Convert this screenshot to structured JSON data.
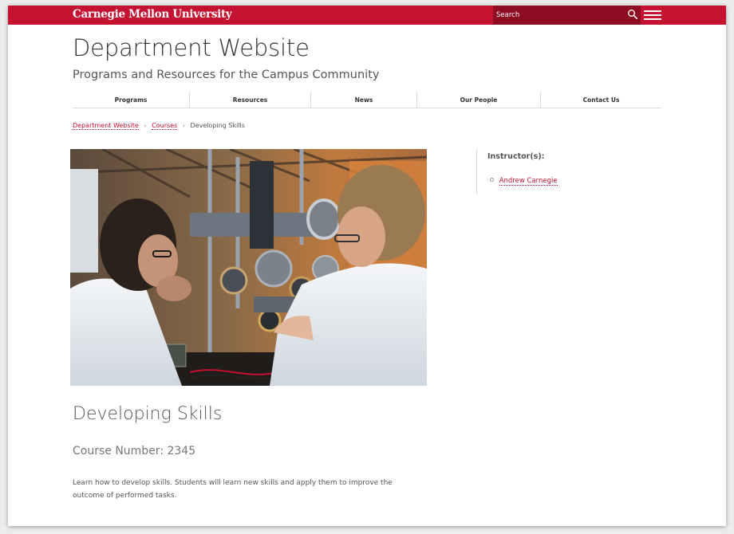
{
  "topbar": {
    "brand": "Carnegie Mellon University",
    "search": {
      "placeholder": "Search"
    },
    "icons": {
      "search": "search-icon",
      "menu": "hamburger-menu-icon"
    },
    "colors": {
      "brand": "#c41230",
      "search_bg": "#8e0d22"
    }
  },
  "header": {
    "title": "Department Website",
    "subtitle": "Programs and Resources for the Campus Community"
  },
  "nav": {
    "items": [
      {
        "label": "Programs"
      },
      {
        "label": "Resources"
      },
      {
        "label": "News"
      },
      {
        "label": "Our People"
      },
      {
        "label": "Contact Us"
      }
    ]
  },
  "breadcrumb": {
    "items": [
      {
        "label": "Department Website"
      },
      {
        "label": "Courses"
      },
      {
        "label": "Developing Skills"
      }
    ],
    "separator": "›"
  },
  "course": {
    "title": "Developing Skills",
    "number": "Course Number: 2345",
    "description": "Learn how to develop skills. Students will learn new skills and apply them to improve the outcome of performed tasks."
  },
  "sidebar": {
    "heading": "Instructor(s):",
    "instructors": [
      {
        "name": "Andrew Carnegie"
      }
    ]
  }
}
